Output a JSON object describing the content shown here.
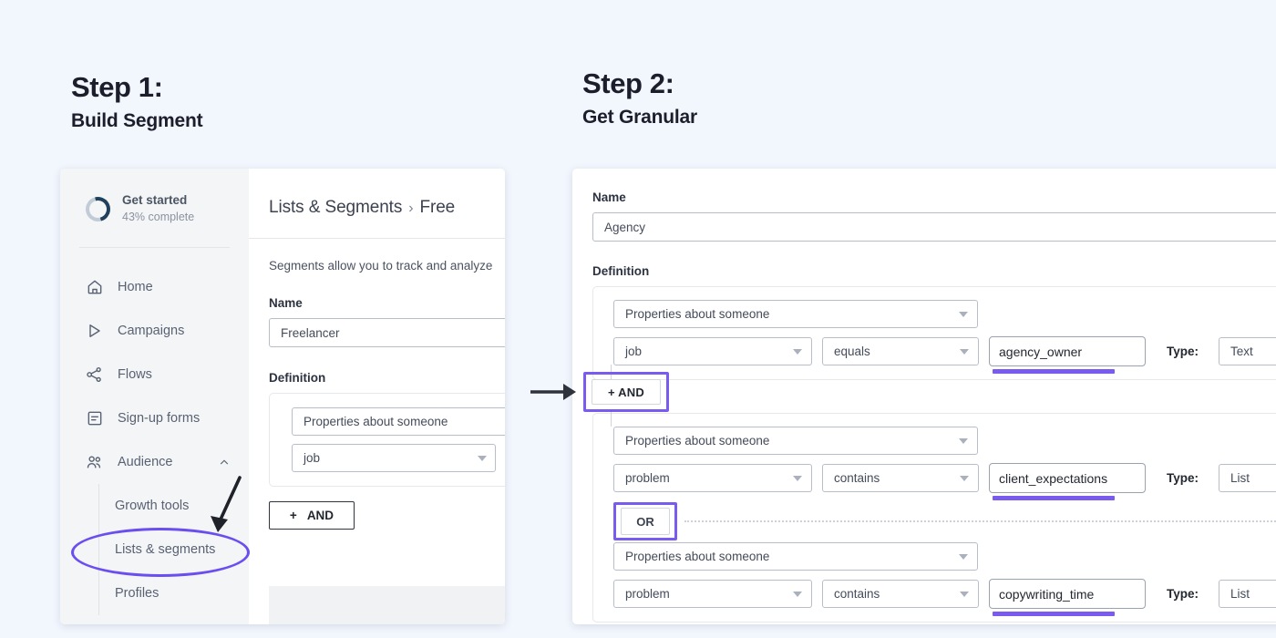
{
  "steps": {
    "step1": {
      "title": "Step 1:",
      "subtitle": "Build Segment"
    },
    "step2": {
      "title": "Step 2:",
      "subtitle": "Get Granular"
    }
  },
  "accent_color": "#7a5bf0",
  "annotation_color": "#6b4ef0",
  "background_color": "#f2f6fd",
  "panel1": {
    "sidebar": {
      "get_started": {
        "title": "Get started",
        "subtitle": "43% complete",
        "progress": 43
      },
      "items": [
        {
          "label": "Home",
          "icon": "home-icon"
        },
        {
          "label": "Campaigns",
          "icon": "campaigns-icon"
        },
        {
          "label": "Flows",
          "icon": "flows-icon"
        },
        {
          "label": "Sign-up forms",
          "icon": "signup-forms-icon"
        },
        {
          "label": "Audience",
          "icon": "audience-icon",
          "expanded": true,
          "chevron": "chevron-up-icon"
        }
      ],
      "subitems": [
        {
          "label": "Growth tools"
        },
        {
          "label": "Lists & segments",
          "highlighted": true
        },
        {
          "label": "Profiles"
        }
      ]
    },
    "main": {
      "breadcrumb": {
        "root": "Lists & Segments",
        "separator": "›",
        "current": "Free"
      },
      "description": "Segments allow you to track and analyze",
      "name_label": "Name",
      "name_value": "Freelancer",
      "definition_label": "Definition",
      "condition": {
        "subject": "Properties about someone",
        "field": "job"
      },
      "and_button": {
        "plus": "+",
        "label": "AND"
      }
    }
  },
  "panel2": {
    "name_label": "Name",
    "name_value": "Agency",
    "definition_label": "Definition",
    "type_label": "Type:",
    "groups": [
      {
        "subject": "Properties about someone",
        "field": "job",
        "operator": "equals",
        "value": "agency_owner",
        "type": "Text"
      },
      {
        "subject": "Properties about someone",
        "field": "problem",
        "operator": "contains",
        "value": "client_expectations",
        "type": "List"
      },
      {
        "subject": "Properties about someone",
        "field": "problem",
        "operator": "contains",
        "value": "copywriting_time",
        "type": "List"
      }
    ],
    "and_button": {
      "label": "+ AND"
    },
    "or_button": {
      "label": "OR"
    }
  }
}
